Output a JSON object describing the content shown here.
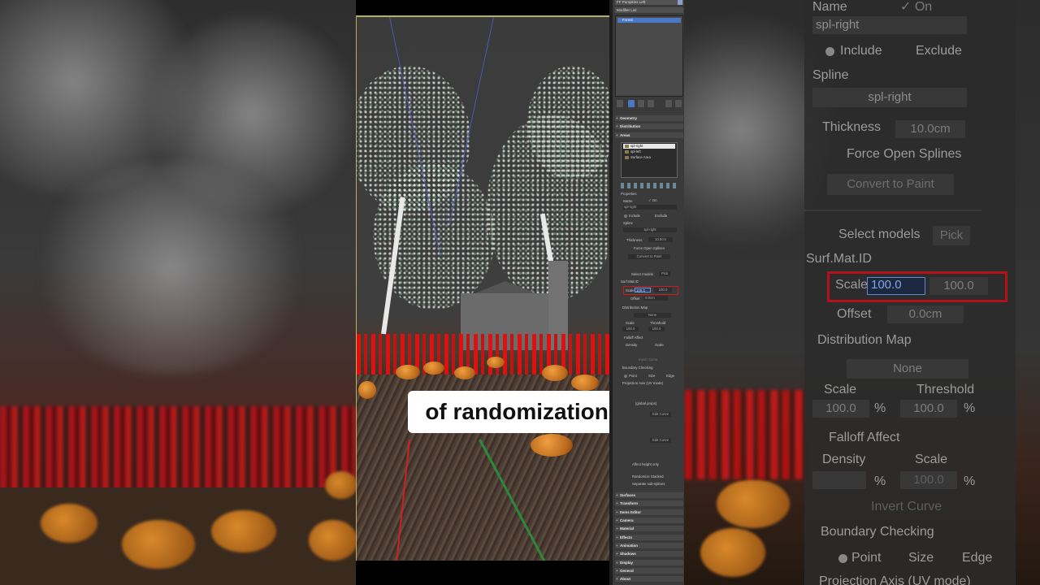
{
  "subtitle": "of randomization.",
  "panel": {
    "object_name": "FF Pumpkins Left",
    "modifier_list_label": "Modifier List",
    "stack_item": "Forest",
    "rollouts_top": [
      "Geometry",
      "Distribution",
      "Areas"
    ],
    "area_list": [
      "spl-right",
      "spl-left",
      "Surface Area"
    ],
    "properties_label": "Properties",
    "name_label": "Name",
    "on_label": "On",
    "name_value": "spl-right",
    "include_label": "Include",
    "exclude_label": "Exclude",
    "spline_label": "Spline",
    "spline_value": "spl-right",
    "thickness_label": "Thickness",
    "thickness_value": "10.0cm",
    "force_open_label": "Force Open Splines",
    "convert_label": "Convert to Paint",
    "select_models_label": "Select models",
    "pick_label": "Pick",
    "surf_mat_label": "Surf.Mat.ID",
    "scale_label": "Scale",
    "scale_value_1": "100.0",
    "scale_value_2": "100.0",
    "offset_label": "Offset",
    "offset_value": "0.0cm",
    "distribution_map_label": "Distribution Map",
    "none_label": "None",
    "dm_scale_label": "Scale",
    "dm_threshold_label": "Threshold",
    "dm_scale_value": "100.0",
    "dm_threshold_value": "100.0",
    "falloff_label": "Falloff Affect",
    "density_label": "Density",
    "fo_scale_label": "Scale",
    "invert_curve_label": "Invert Curve",
    "boundary_label": "Boundary Checking",
    "point_label": "Point",
    "size_label": "Size",
    "edge_label": "Edge",
    "projection_label": "Projection Axis (UV mode)",
    "global_props_label": "(global props)",
    "edit_curve_label": "Edit Curve",
    "affect_height_label": "Affect height only",
    "randomize_stacked_label": "Randomize Stacked",
    "separate_subsplines_label": "Separate sub-splines",
    "rollouts_bottom": [
      "Surfaces",
      "Transform",
      "Items Editor",
      "Camera",
      "Material",
      "Effects",
      "Animation",
      "Shadows",
      "Display",
      "General",
      "About"
    ]
  },
  "zoom": {
    "name_label": "Name",
    "on_label": "On",
    "name_value": "spl-right",
    "include_label": "Include",
    "exclude_label": "Exclude",
    "spline_label": "Spline",
    "spline_value": "spl-right",
    "thickness_label": "Thickness",
    "thickness_value": "10.0cm",
    "force_open_label": "Force Open Splines",
    "convert_label": "Convert to Paint",
    "select_models_label": "Select models",
    "pick_label": "Pick",
    "surf_mat_label": "Surf.Mat.ID",
    "scale_label": "Scale",
    "scale_value_1": "100.0",
    "scale_value_2": "100.0",
    "offset_label": "Offset",
    "offset_value": "0.0cm",
    "distribution_map_label": "Distribution Map",
    "none_label": "None",
    "dm_scale_label": "Scale",
    "dm_threshold_label": "Threshold",
    "dm_scale_value": "100.0",
    "dm_threshold_value": "100.0",
    "percent": "%",
    "falloff_label": "Falloff Affect",
    "density_label": "Density",
    "fo_scale_label": "Scale",
    "fo_scale_value": "100.0",
    "invert_curve_label": "Invert Curve",
    "boundary_label": "Boundary Checking",
    "point_label": "Point",
    "size_label": "Size",
    "edge_label": "Edge",
    "projection_label": "Projection Axis (UV mode)"
  },
  "colors": {
    "highlight_red": "#b3121b",
    "selection_blue": "#4a78c4",
    "panel_bg": "#3a3a3a"
  }
}
